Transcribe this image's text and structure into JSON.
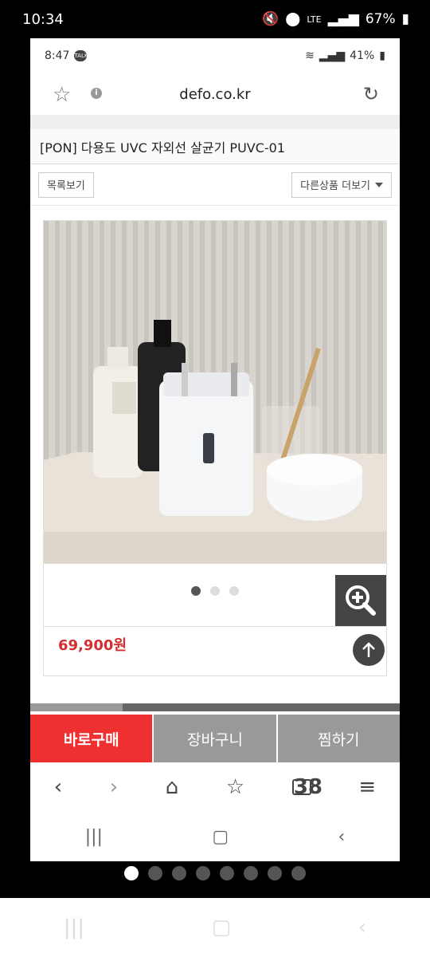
{
  "outer_status": {
    "time": "10:34",
    "network": "LTE",
    "battery": "67%"
  },
  "inner_status": {
    "time": "8:47",
    "chat_badge": "TALK",
    "battery": "41%"
  },
  "browser": {
    "url": "defo.co.kr"
  },
  "product": {
    "title": "[PON] 다용도 UVC 자외선 살균기 PUVC-01",
    "list_button": "목록보기",
    "more_button": "다른상품 더보기",
    "price": "69,900원",
    "image_dots": 3,
    "active_image": 0
  },
  "actions": {
    "buy": "바로구매",
    "cart": "장바구니",
    "wish": "찜하기"
  },
  "nav": {
    "tab_count": "38"
  },
  "launcher_pages": {
    "count": 8,
    "active": 0
  },
  "colors": {
    "buy": "#ef3030",
    "price": "#d32f2f",
    "grey": "#999999"
  }
}
